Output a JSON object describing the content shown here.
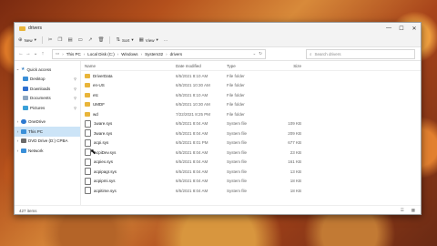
{
  "window": {
    "title": "drivers",
    "controls": {
      "minimize": "—",
      "maximize": "☐",
      "close": "✕"
    }
  },
  "commandbar": {
    "new_label": "New",
    "sort_label": "Sort",
    "view_label": "View",
    "more_label": "···"
  },
  "address": {
    "crumbs": [
      "This PC",
      "Local Disk (C:)",
      "Windows",
      "System32",
      "drivers"
    ],
    "search_placeholder": "Search drivers"
  },
  "sidebar": {
    "items": [
      {
        "label": "Quick access",
        "icon": "star-icon",
        "color": "#3b82c4"
      },
      {
        "label": "Desktop",
        "icon": "desktop-icon",
        "color": "#3a8fd8"
      },
      {
        "label": "Downloads",
        "icon": "download-icon",
        "color": "#2f6fcf"
      },
      {
        "label": "Documents",
        "icon": "documents-icon",
        "color": "#8ea7c2"
      },
      {
        "label": "Pictures",
        "icon": "pictures-icon",
        "color": "#3aa0d8"
      },
      {
        "label": "OneDrive",
        "icon": "cloud-icon",
        "color": "#2f7ad0"
      },
      {
        "label": "This PC",
        "icon": "pc-icon",
        "color": "#3a8fd8"
      },
      {
        "label": "DVD Drive (D:) CPBA",
        "icon": "dvd-icon",
        "color": "#6b6b6b"
      },
      {
        "label": "Network",
        "icon": "network-icon",
        "color": "#3a8fd8"
      }
    ]
  },
  "columns": {
    "name": "Name",
    "date": "Date modified",
    "type": "Type",
    "size": "Size"
  },
  "files": [
    {
      "name": "DriverData",
      "date": "6/5/2021 8:10 AM",
      "type": "File folder",
      "size": "",
      "kind": "folder"
    },
    {
      "name": "en-US",
      "date": "6/5/2021 10:30 AM",
      "type": "File folder",
      "size": "",
      "kind": "folder"
    },
    {
      "name": "etc",
      "date": "6/5/2021 8:10 AM",
      "type": "File folder",
      "size": "",
      "kind": "folder"
    },
    {
      "name": "UMDF",
      "date": "6/5/2021 10:30 AM",
      "type": "File folder",
      "size": "",
      "kind": "folder"
    },
    {
      "name": "wd",
      "date": "7/22/2021 8:25 PM",
      "type": "File folder",
      "size": "",
      "kind": "folder"
    },
    {
      "name": "1ware.sys",
      "date": "6/5/2021 8:04 AM",
      "type": "System file",
      "size": "109 KB",
      "kind": "sys"
    },
    {
      "name": "3ware.sys",
      "date": "6/5/2021 8:04 AM",
      "type": "System file",
      "size": "209 KB",
      "kind": "sys"
    },
    {
      "name": "acpi.sys",
      "date": "6/5/2021 8:01 PM",
      "type": "System file",
      "size": "677 KB",
      "kind": "sys"
    },
    {
      "name": "AcpiDev.sys",
      "date": "6/5/2021 8:04 AM",
      "type": "System file",
      "size": "23 KB",
      "kind": "sys"
    },
    {
      "name": "acpiex.sys",
      "date": "6/5/2021 8:04 AM",
      "type": "System file",
      "size": "161 KB",
      "kind": "sys"
    },
    {
      "name": "acpipagr.sys",
      "date": "6/5/2021 8:04 AM",
      "type": "System file",
      "size": "13 KB",
      "kind": "sys"
    },
    {
      "name": "acpipmi.sys",
      "date": "6/5/2021 8:04 AM",
      "type": "System file",
      "size": "18 KB",
      "kind": "sys"
    },
    {
      "name": "acpitime.sys",
      "date": "6/5/2021 8:04 AM",
      "type": "System file",
      "size": "18 KB",
      "kind": "sys"
    }
  ],
  "status": {
    "item_count": "427 items"
  }
}
